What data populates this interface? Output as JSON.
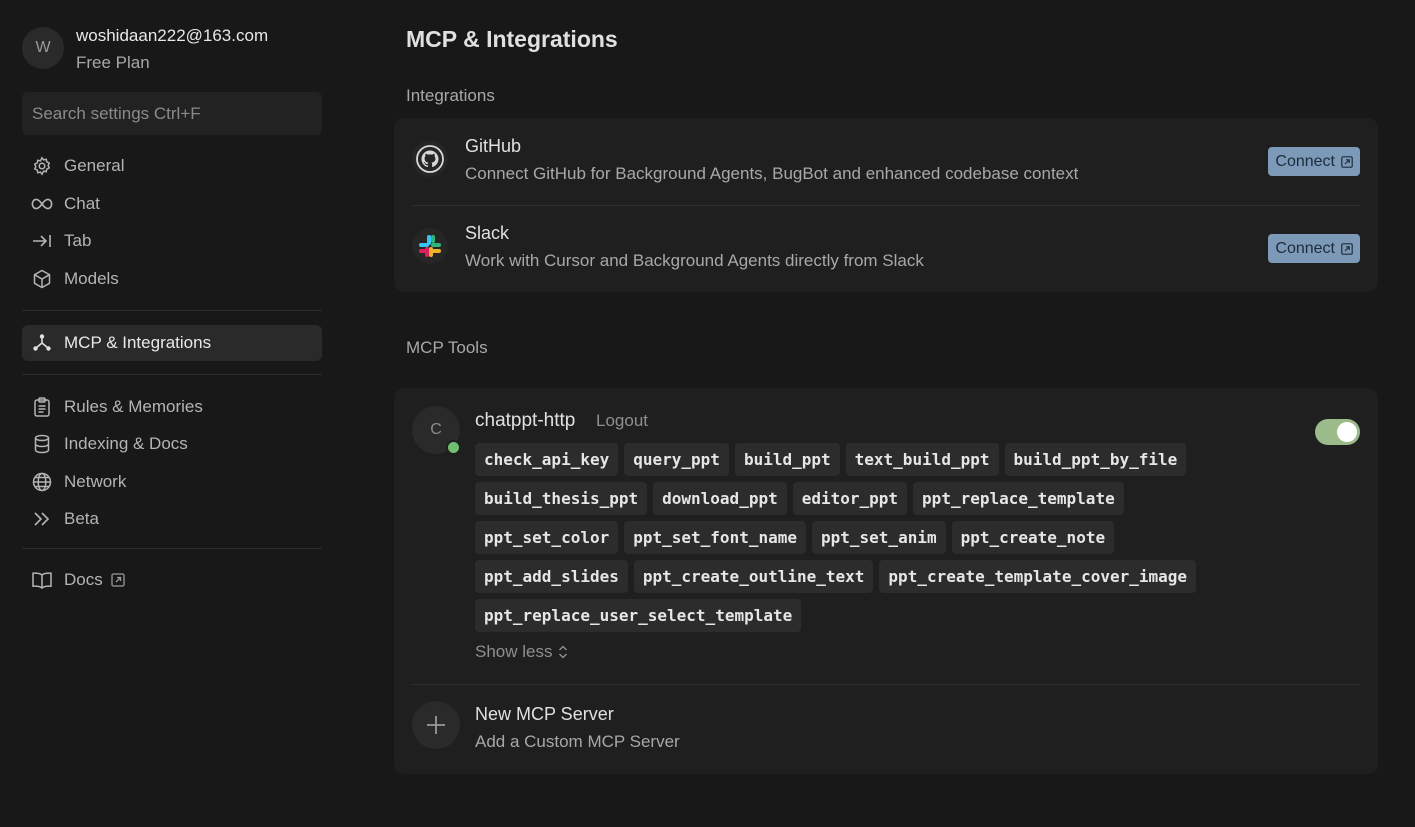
{
  "account": {
    "avatar_letter": "W",
    "email": "woshidaan222@163.com",
    "plan": "Free Plan"
  },
  "search": {
    "placeholder": "Search settings Ctrl+F"
  },
  "sidebar": {
    "groups": [
      [
        {
          "label": "General",
          "icon": "gear-icon"
        },
        {
          "label": "Chat",
          "icon": "infinity-icon"
        },
        {
          "label": "Tab",
          "icon": "arrow-right-bar-icon"
        },
        {
          "label": "Models",
          "icon": "cube-icon"
        }
      ],
      [
        {
          "label": "MCP & Integrations",
          "icon": "nodes-icon",
          "active": true
        }
      ],
      [
        {
          "label": "Rules & Memories",
          "icon": "clipboard-icon"
        },
        {
          "label": "Indexing & Docs",
          "icon": "database-icon"
        },
        {
          "label": "Network",
          "icon": "globe-icon"
        },
        {
          "label": "Beta",
          "icon": "double-chevron-icon"
        }
      ],
      [
        {
          "label": "Docs",
          "icon": "book-icon",
          "external": true
        }
      ]
    ]
  },
  "main": {
    "title": "MCP & Integrations",
    "integrations_title": "Integrations",
    "integrations": [
      {
        "name": "GitHub",
        "description": "Connect GitHub for Background Agents, BugBot and enhanced codebase context",
        "icon": "github-icon",
        "button": "Connect"
      },
      {
        "name": "Slack",
        "description": "Work with Cursor and Background Agents directly from Slack",
        "icon": "slack-icon",
        "button": "Connect"
      }
    ],
    "mcp_title": "MCP Tools",
    "mcp_server": {
      "avatar_letter": "C",
      "name": "chatppt-http",
      "logout": "Logout",
      "enabled": true,
      "status_color": "#6fbf73",
      "tool_rows": [
        [
          "check_api_key",
          "query_ppt",
          "build_ppt",
          "text_build_ppt",
          "build_ppt_by_file"
        ],
        [
          "build_thesis_ppt",
          "download_ppt",
          "editor_ppt",
          "ppt_replace_template"
        ],
        [
          "ppt_set_color",
          "ppt_set_font_name",
          "ppt_set_anim",
          "ppt_create_note"
        ],
        [
          "ppt_add_slides",
          "ppt_create_outline_text",
          "ppt_create_template_cover_image"
        ],
        [
          "ppt_replace_user_select_template"
        ]
      ],
      "show_less": "Show less"
    },
    "new_server": {
      "title": "New MCP Server",
      "subtitle": "Add a Custom MCP Server"
    }
  },
  "colors": {
    "background": "#181818",
    "card": "#1f1f1f",
    "connect_button": "#7d99b8",
    "toggle_on": "#9bbb8b"
  }
}
